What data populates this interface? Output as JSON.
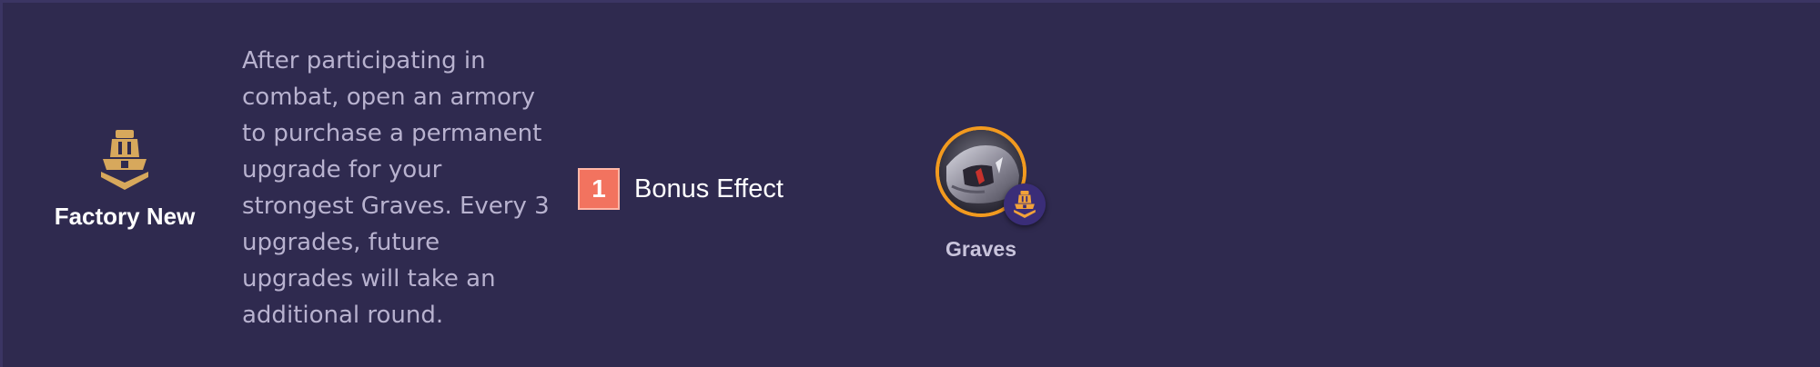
{
  "trait": {
    "name": "Factory New",
    "icon": "factory-new-trait-icon",
    "description": "After participating in combat, open an armory to purchase a permanent upgrade for your strongest Graves. Every 3 upgrades, future upgrades will take an additional round."
  },
  "bonus": {
    "count": "1",
    "label": "Bonus Effect",
    "badge_color": "#f2735f"
  },
  "champion": {
    "name": "Graves",
    "ring_color": "#f29a1f",
    "badge_icon": "factory-new-trait-icon"
  },
  "colors": {
    "background": "#2f2a4f",
    "trait_gold": "#d7a85c"
  }
}
